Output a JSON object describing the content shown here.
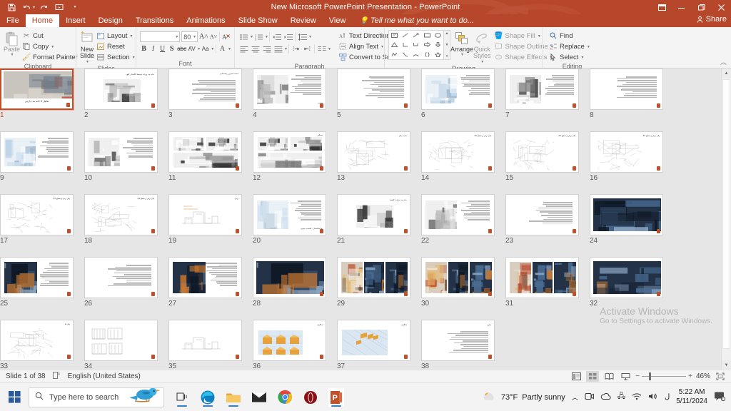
{
  "window": {
    "title": "New Microsoft PowerPoint Presentation - PowerPoint",
    "qat": [
      {
        "name": "save",
        "label": "Save"
      },
      {
        "name": "undo",
        "label": "Undo"
      },
      {
        "name": "redo",
        "label": "Redo"
      },
      {
        "name": "start-slideshow",
        "label": "Start From Beginning"
      },
      {
        "name": "customize-qat",
        "label": "Customize Quick Access Toolbar"
      }
    ],
    "buttons": {
      "ribbon_display": "Ribbon Display Options",
      "minimize": "Minimize",
      "restore": "Restore Down",
      "close": "Close"
    }
  },
  "tabs": [
    {
      "label": "File",
      "active": false
    },
    {
      "label": "Home",
      "active": true
    },
    {
      "label": "Insert",
      "active": false
    },
    {
      "label": "Design",
      "active": false
    },
    {
      "label": "Transitions",
      "active": false
    },
    {
      "label": "Animations",
      "active": false
    },
    {
      "label": "Slide Show",
      "active": false
    },
    {
      "label": "Review",
      "active": false
    },
    {
      "label": "View",
      "active": false
    }
  ],
  "tellme": "Tell me what you want to do...",
  "share": "Share",
  "ribbon": {
    "clipboard": {
      "label": "Clipboard",
      "paste": "Paste",
      "cut": "Cut",
      "copy": "Copy",
      "format_painter": "Format Painter"
    },
    "slides": {
      "label": "Slides",
      "new_slide": "New\nSlide",
      "layout": "Layout",
      "reset": "Reset",
      "section": "Section"
    },
    "font": {
      "label": "Font",
      "font_name": "",
      "font_size": "80",
      "increase": "A",
      "decrease": "A",
      "clear_formatting": "Clear All Formatting",
      "bold": "B",
      "italic": "I",
      "underline": "U",
      "shadow": "S",
      "strikethrough": "abc",
      "character_spacing": "AV",
      "change_case": "Aa",
      "font_color": "A"
    },
    "paragraph": {
      "label": "Paragraph",
      "text_direction": "Text Direction",
      "align_text": "Align Text",
      "convert_smartart": "Convert to SmartArt"
    },
    "drawing": {
      "label": "Drawing",
      "arrange": "Arrange",
      "quick_styles": "Quick\nStyles",
      "shape_fill": "Shape Fill",
      "shape_outline": "Shape Outline",
      "shape_effects": "Shape Effects"
    },
    "editing": {
      "label": "Editing",
      "find": "Find",
      "replace": "Replace",
      "select": "Select"
    },
    "collapse": "Collapse the Ribbon"
  },
  "slides": {
    "count": 38,
    "selected": 1,
    "items": [
      {
        "n": "1",
        "title": "تحلیل 2 خانه مد خارجی",
        "kind": "cover"
      },
      {
        "n": "2",
        "title": "خانه مد ورباند توسط گلاسائر کئوه",
        "kind": "title-image"
      },
      {
        "n": "3",
        "title": "محمد اصغری رفسنجانی",
        "kind": "text-only"
      },
      {
        "n": "4",
        "title": "مقدمه",
        "kind": "image-text"
      },
      {
        "n": "5",
        "title": "",
        "kind": "text-only"
      },
      {
        "n": "6",
        "title": "",
        "kind": "image-text"
      },
      {
        "n": "7",
        "title": "",
        "kind": "image-text"
      },
      {
        "n": "8",
        "title": "",
        "kind": "text-only"
      },
      {
        "n": "9",
        "title": "",
        "kind": "image-text"
      },
      {
        "n": "10",
        "title": "",
        "kind": "image-text"
      },
      {
        "n": "11",
        "title": "",
        "kind": "image-grid"
      },
      {
        "n": "12",
        "title": "مصالح",
        "kind": "image-grid"
      },
      {
        "n": "13",
        "title": "سایت پلان",
        "kind": "plan"
      },
      {
        "n": "14",
        "title": "پلان برش و سطح 00",
        "kind": "plan"
      },
      {
        "n": "15",
        "title": "پلان برش و سطح 01",
        "kind": "plan"
      },
      {
        "n": "16",
        "title": "پلان برش و سطح 02",
        "kind": "plan"
      },
      {
        "n": "17",
        "title": "پلان برش و سطح 03",
        "kind": "plan"
      },
      {
        "n": "18",
        "title": "پلان برش و سطح 04",
        "kind": "plan"
      },
      {
        "n": "19",
        "title": "برش",
        "kind": "section"
      },
      {
        "n": "20",
        "title": "نما ساختمان - قسمت جنوبی",
        "kind": "image-text"
      },
      {
        "n": "21",
        "title": "خانه مد تران | کلمبیا",
        "kind": "title-image"
      },
      {
        "n": "22",
        "title": "",
        "kind": "image-text"
      },
      {
        "n": "23",
        "title": "",
        "kind": "text-only"
      },
      {
        "n": "24",
        "title": "",
        "kind": "photo"
      },
      {
        "n": "25",
        "title": "",
        "kind": "photo-text"
      },
      {
        "n": "26",
        "title": "",
        "kind": "text-only"
      },
      {
        "n": "27",
        "title": "",
        "kind": "photo-text"
      },
      {
        "n": "28",
        "title": "",
        "kind": "photo"
      },
      {
        "n": "29",
        "title": "",
        "kind": "photo-grid"
      },
      {
        "n": "30",
        "title": "",
        "kind": "photo-grid"
      },
      {
        "n": "31",
        "title": "",
        "kind": "photo-grid"
      },
      {
        "n": "32",
        "title": "",
        "kind": "photo"
      },
      {
        "n": "33",
        "title": "پلان ها",
        "kind": "plan"
      },
      {
        "n": "34",
        "title": "",
        "kind": "elevation"
      },
      {
        "n": "35",
        "title": "",
        "kind": "section"
      },
      {
        "n": "36",
        "title": "دیاگرام",
        "kind": "diagram"
      },
      {
        "n": "37",
        "title": "دیاگرام",
        "kind": "diagram3d"
      },
      {
        "n": "38",
        "title": "منابع",
        "kind": "text-only"
      }
    ]
  },
  "status": {
    "slide_info": "Slide 1 of 38",
    "notes_icon": "notes-icon",
    "language": "English (United States)",
    "views": [
      "Normal",
      "Slide Sorter",
      "Reading View",
      "Slide Show"
    ],
    "active_view": "Slide Sorter",
    "zoom": "46%",
    "fit_to_window": "Fit slide to current window"
  },
  "watermark": {
    "line1": "Activate Windows",
    "line2": "Go to Settings to activate Windows."
  },
  "taskbar": {
    "start": "Start",
    "search_placeholder": "Type here to search",
    "task_view": "Task View",
    "apps": [
      {
        "name": "edge-icon",
        "label": "Microsoft Edge",
        "running": true
      },
      {
        "name": "file-explorer-icon",
        "label": "File Explorer",
        "running": true
      },
      {
        "name": "mail-icon",
        "label": "Mail",
        "running": false
      },
      {
        "name": "chrome-icon",
        "label": "Google Chrome",
        "running": false
      },
      {
        "name": "opera-icon",
        "label": "Opera",
        "running": false
      },
      {
        "name": "powerpoint-icon",
        "label": "PowerPoint",
        "running": true
      }
    ],
    "weather": {
      "temp": "73°F",
      "condition": "Partly sunny"
    },
    "tray": [
      "show-hidden-icons",
      "teams-icon",
      "onedrive-icon",
      "network-icon",
      "wifi-icon",
      "volume-icon",
      "ime-icon"
    ],
    "time": "5:22 AM",
    "date": "5/11/2024",
    "notifications": "Notifications"
  },
  "colors": {
    "accent": "#b7472a",
    "selection": "#c0502a",
    "ribbon_bg": "#f4f4f4",
    "pane_bg": "#e6e6e6"
  }
}
